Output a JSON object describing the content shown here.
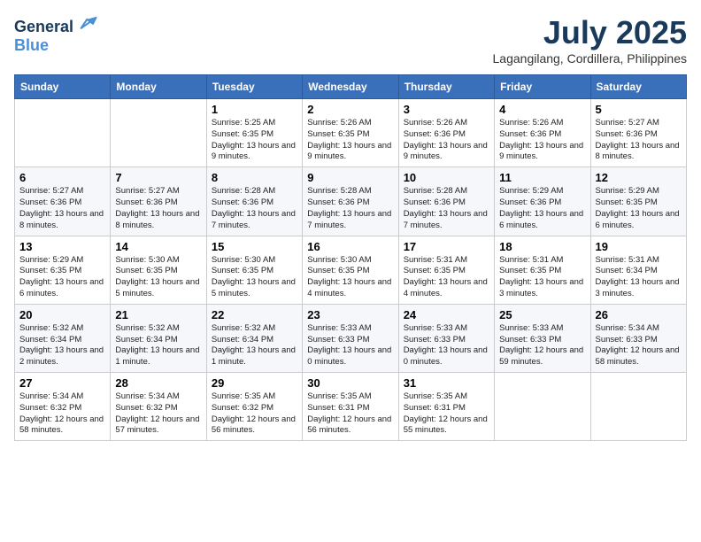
{
  "header": {
    "logo_line1": "General",
    "logo_line2": "Blue",
    "month_year": "July 2025",
    "location": "Lagangilang, Cordillera, Philippines"
  },
  "days": [
    "Sunday",
    "Monday",
    "Tuesday",
    "Wednesday",
    "Thursday",
    "Friday",
    "Saturday"
  ],
  "weeks": [
    [
      {
        "date": "",
        "content": ""
      },
      {
        "date": "",
        "content": ""
      },
      {
        "date": "1",
        "content": "Sunrise: 5:25 AM\nSunset: 6:35 PM\nDaylight: 13 hours and 9 minutes."
      },
      {
        "date": "2",
        "content": "Sunrise: 5:26 AM\nSunset: 6:35 PM\nDaylight: 13 hours and 9 minutes."
      },
      {
        "date": "3",
        "content": "Sunrise: 5:26 AM\nSunset: 6:36 PM\nDaylight: 13 hours and 9 minutes."
      },
      {
        "date": "4",
        "content": "Sunrise: 5:26 AM\nSunset: 6:36 PM\nDaylight: 13 hours and 9 minutes."
      },
      {
        "date": "5",
        "content": "Sunrise: 5:27 AM\nSunset: 6:36 PM\nDaylight: 13 hours and 8 minutes."
      }
    ],
    [
      {
        "date": "6",
        "content": "Sunrise: 5:27 AM\nSunset: 6:36 PM\nDaylight: 13 hours and 8 minutes."
      },
      {
        "date": "7",
        "content": "Sunrise: 5:27 AM\nSunset: 6:36 PM\nDaylight: 13 hours and 8 minutes."
      },
      {
        "date": "8",
        "content": "Sunrise: 5:28 AM\nSunset: 6:36 PM\nDaylight: 13 hours and 7 minutes."
      },
      {
        "date": "9",
        "content": "Sunrise: 5:28 AM\nSunset: 6:36 PM\nDaylight: 13 hours and 7 minutes."
      },
      {
        "date": "10",
        "content": "Sunrise: 5:28 AM\nSunset: 6:36 PM\nDaylight: 13 hours and 7 minutes."
      },
      {
        "date": "11",
        "content": "Sunrise: 5:29 AM\nSunset: 6:36 PM\nDaylight: 13 hours and 6 minutes."
      },
      {
        "date": "12",
        "content": "Sunrise: 5:29 AM\nSunset: 6:35 PM\nDaylight: 13 hours and 6 minutes."
      }
    ],
    [
      {
        "date": "13",
        "content": "Sunrise: 5:29 AM\nSunset: 6:35 PM\nDaylight: 13 hours and 6 minutes."
      },
      {
        "date": "14",
        "content": "Sunrise: 5:30 AM\nSunset: 6:35 PM\nDaylight: 13 hours and 5 minutes."
      },
      {
        "date": "15",
        "content": "Sunrise: 5:30 AM\nSunset: 6:35 PM\nDaylight: 13 hours and 5 minutes."
      },
      {
        "date": "16",
        "content": "Sunrise: 5:30 AM\nSunset: 6:35 PM\nDaylight: 13 hours and 4 minutes."
      },
      {
        "date": "17",
        "content": "Sunrise: 5:31 AM\nSunset: 6:35 PM\nDaylight: 13 hours and 4 minutes."
      },
      {
        "date": "18",
        "content": "Sunrise: 5:31 AM\nSunset: 6:35 PM\nDaylight: 13 hours and 3 minutes."
      },
      {
        "date": "19",
        "content": "Sunrise: 5:31 AM\nSunset: 6:34 PM\nDaylight: 13 hours and 3 minutes."
      }
    ],
    [
      {
        "date": "20",
        "content": "Sunrise: 5:32 AM\nSunset: 6:34 PM\nDaylight: 13 hours and 2 minutes."
      },
      {
        "date": "21",
        "content": "Sunrise: 5:32 AM\nSunset: 6:34 PM\nDaylight: 13 hours and 1 minute."
      },
      {
        "date": "22",
        "content": "Sunrise: 5:32 AM\nSunset: 6:34 PM\nDaylight: 13 hours and 1 minute."
      },
      {
        "date": "23",
        "content": "Sunrise: 5:33 AM\nSunset: 6:33 PM\nDaylight: 13 hours and 0 minutes."
      },
      {
        "date": "24",
        "content": "Sunrise: 5:33 AM\nSunset: 6:33 PM\nDaylight: 13 hours and 0 minutes."
      },
      {
        "date": "25",
        "content": "Sunrise: 5:33 AM\nSunset: 6:33 PM\nDaylight: 12 hours and 59 minutes."
      },
      {
        "date": "26",
        "content": "Sunrise: 5:34 AM\nSunset: 6:33 PM\nDaylight: 12 hours and 58 minutes."
      }
    ],
    [
      {
        "date": "27",
        "content": "Sunrise: 5:34 AM\nSunset: 6:32 PM\nDaylight: 12 hours and 58 minutes."
      },
      {
        "date": "28",
        "content": "Sunrise: 5:34 AM\nSunset: 6:32 PM\nDaylight: 12 hours and 57 minutes."
      },
      {
        "date": "29",
        "content": "Sunrise: 5:35 AM\nSunset: 6:32 PM\nDaylight: 12 hours and 56 minutes."
      },
      {
        "date": "30",
        "content": "Sunrise: 5:35 AM\nSunset: 6:31 PM\nDaylight: 12 hours and 56 minutes."
      },
      {
        "date": "31",
        "content": "Sunrise: 5:35 AM\nSunset: 6:31 PM\nDaylight: 12 hours and 55 minutes."
      },
      {
        "date": "",
        "content": ""
      },
      {
        "date": "",
        "content": ""
      }
    ]
  ]
}
